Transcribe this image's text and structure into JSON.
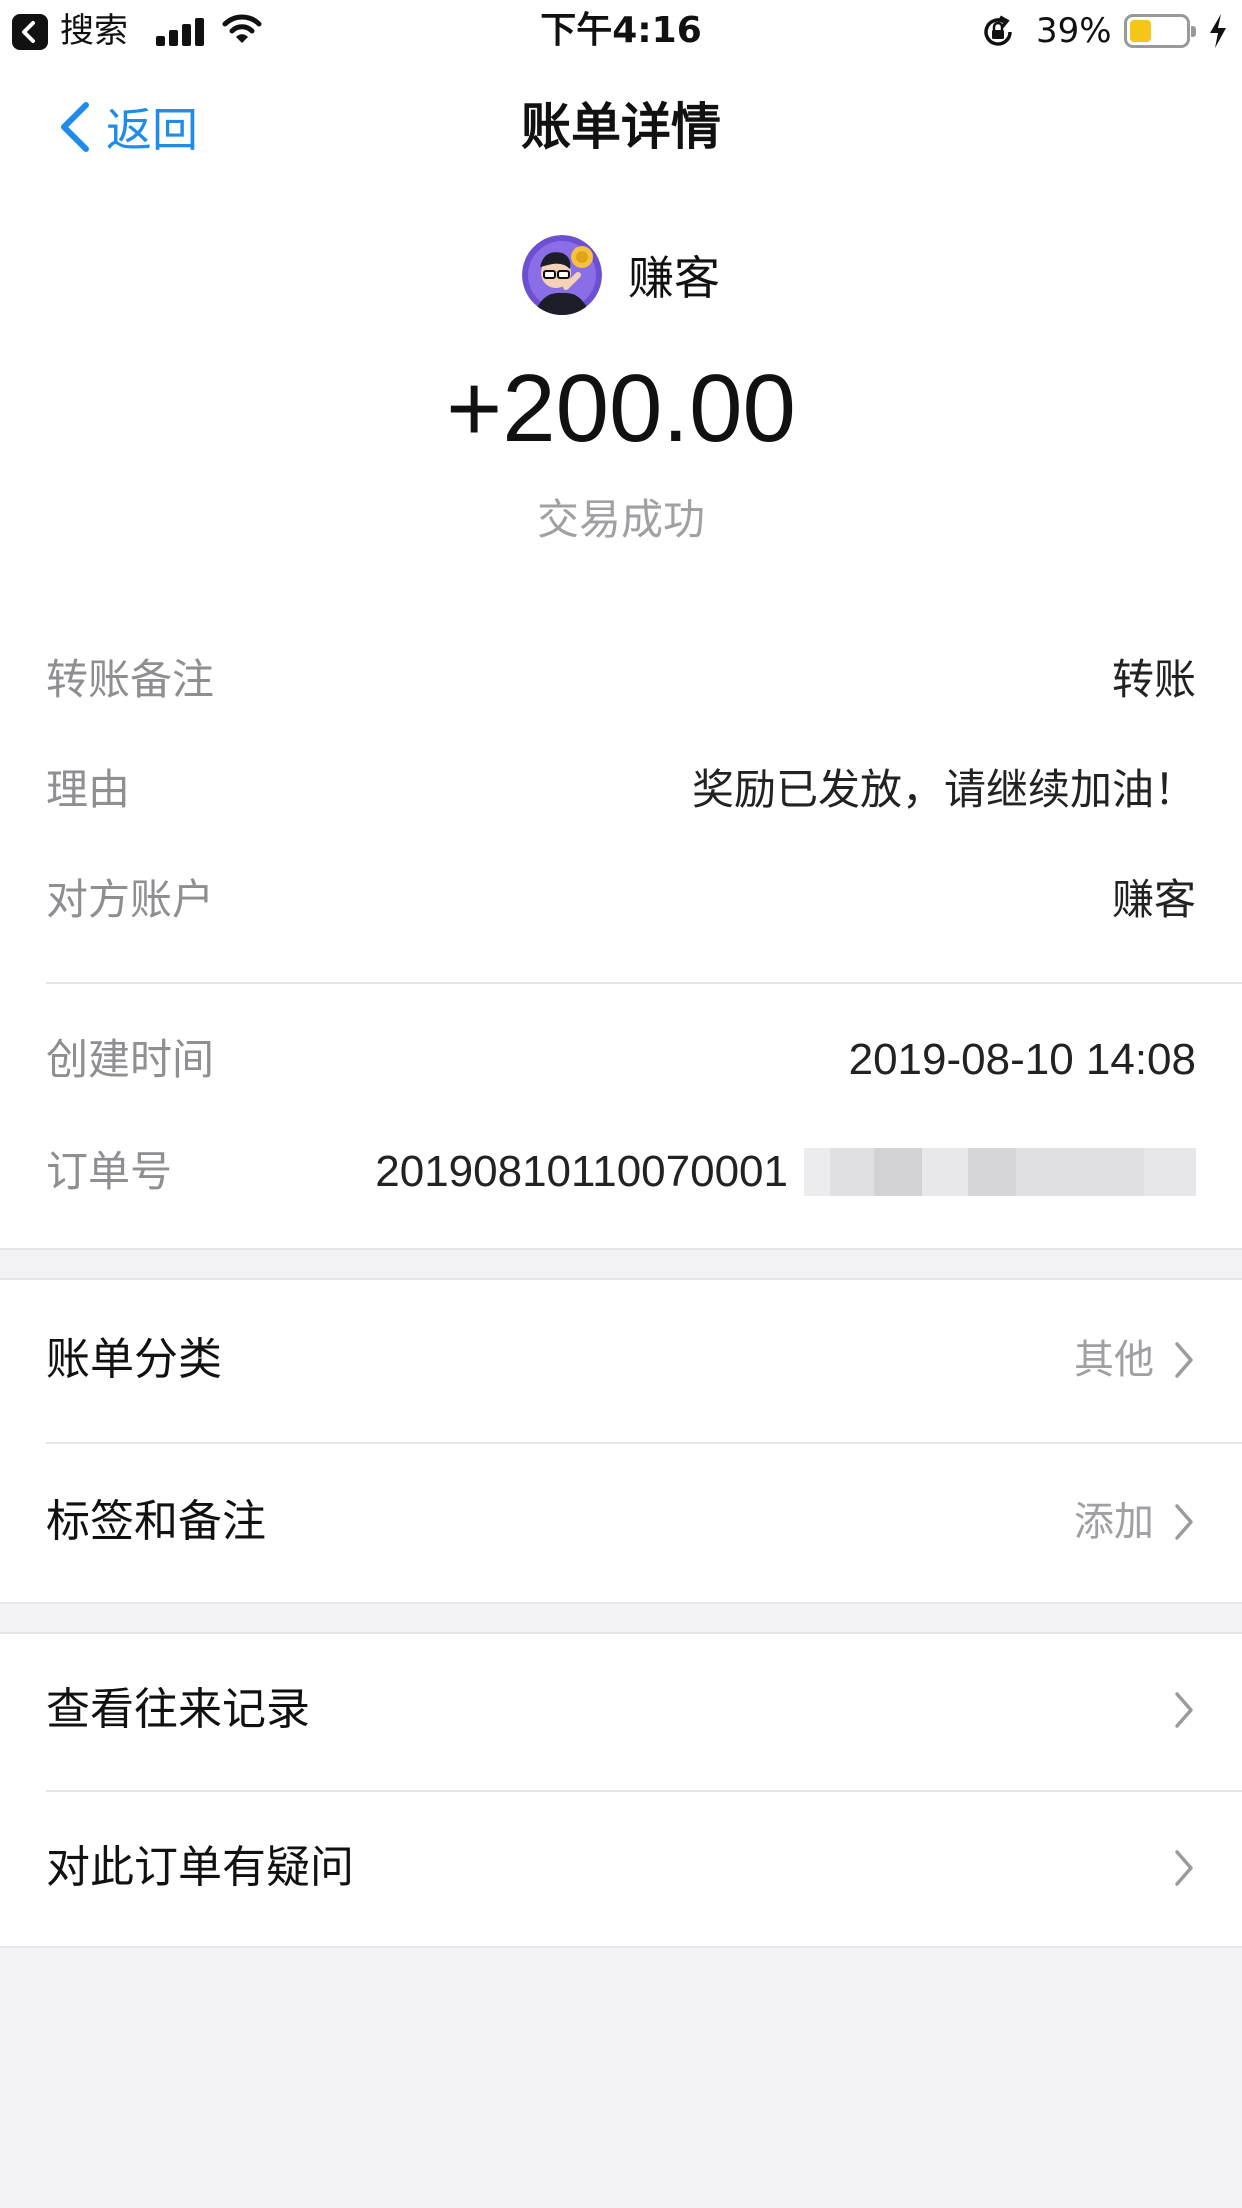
{
  "status_bar": {
    "back_app": "搜索",
    "time": "下午4:16",
    "battery_percent": "39%",
    "battery_level": 0.39,
    "battery_color": "#f5c518"
  },
  "nav": {
    "back_label": "返回",
    "title": "账单详情",
    "accent_color": "#1f8ceb"
  },
  "header": {
    "merchant_name": "赚客",
    "amount": "+200.00",
    "status": "交易成功"
  },
  "details": [
    {
      "key": "转账备注",
      "value": "转账"
    },
    {
      "key": "理由",
      "value": "奖励已发放，请继续加油！"
    },
    {
      "key": "对方账户",
      "value": "赚客"
    }
  ],
  "details2": [
    {
      "key": "创建时间",
      "value": "2019-08-10 14:08"
    },
    {
      "key": "订单号",
      "value": "20190810110070001"
    }
  ],
  "menu_group1": [
    {
      "label": "账单分类",
      "value": "其他"
    },
    {
      "label": "标签和备注",
      "value": "添加"
    }
  ],
  "menu_group2": [
    {
      "label": "查看往来记录"
    },
    {
      "label": "对此订单有疑问"
    }
  ],
  "icons": {
    "chevron": "chevron-right-icon",
    "back": "chevron-left-icon",
    "avatar": "merchant-avatar"
  }
}
